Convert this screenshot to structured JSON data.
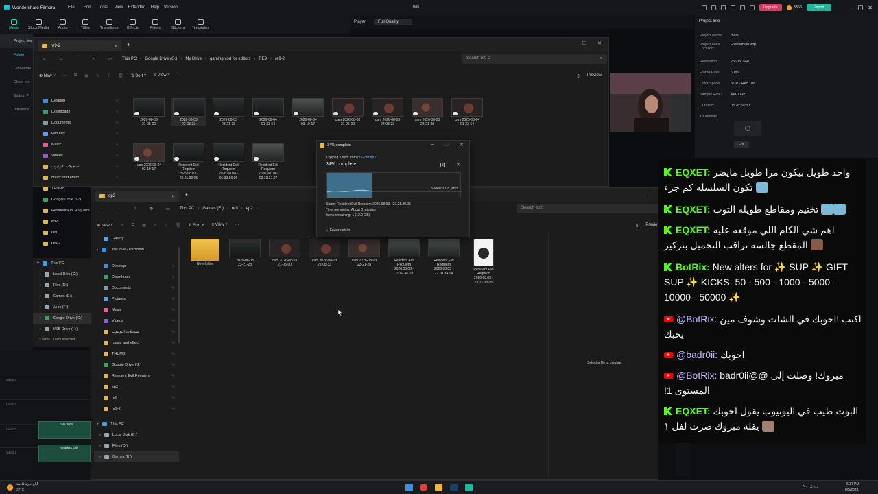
{
  "filmora": {
    "app_title": "Wondershare Filmora",
    "menu": [
      "File",
      "Edit",
      "Tools",
      "View",
      "Extended",
      "Help",
      "Version"
    ],
    "project": "main",
    "upgrade": "Upgrade",
    "credits": "3366",
    "export": "Export",
    "tools": [
      "Media",
      "Stock Media",
      "Audio",
      "Titles",
      "Transitions",
      "Effects",
      "Filters",
      "Stickers",
      "Templates"
    ],
    "left_items": [
      "Project Me",
      "Folder",
      "Global Me",
      "Cloud Me",
      "Editing Pr",
      "Influence"
    ],
    "player": {
      "label": "Player",
      "quality": "Full Quality"
    },
    "info": {
      "tab": "Project Info",
      "rows": [
        [
          "Project Name:",
          "main"
        ],
        [
          "Project Files Location:",
          "E:/re9/main.wfp"
        ],
        [
          "Resolution:",
          "2560 x 1440"
        ],
        [
          "Frame Rate:",
          "60fps"
        ],
        [
          "Color Space:",
          "SDR - Rec.709"
        ],
        [
          "Sample Rate:",
          "44100Hz"
        ],
        [
          "Duration:",
          "03:26:59:30"
        ],
        [
          "Thumbnail:",
          ""
        ]
      ],
      "edit": "Edit"
    },
    "timeline": {
      "tracks": [
        "Video 4",
        "Video 3",
        "Video 2",
        "Video 1"
      ],
      "clip_label": "Resident Evil",
      "clip_label2": "cam 2026"
    }
  },
  "explorer_back": {
    "tab": "re9-2",
    "crumbs": [
      "This PC",
      "Google Drive (G:)",
      "My Drive",
      "gaming vod for editors",
      "RE9",
      "re9-2"
    ],
    "search": "Search re9-2",
    "toolbar": {
      "new": "New",
      "sort": "Sort",
      "view": "View",
      "preview": "Preview"
    },
    "sidebar": [
      "Desktop",
      "Downloads",
      "Documents",
      "Pictures",
      "Music",
      "Videos",
      "تسجيلات اليوتيوب",
      "music and effect",
      "THUMB",
      "Google Drive (G:)",
      "Resident Evil Requiem",
      "ep2",
      "re9",
      "re9-2"
    ],
    "files": [
      [
        "2026-08-03",
        "21-05-00"
      ],
      [
        "2026-08-03",
        "22-08-33"
      ],
      [
        "2026-08-03",
        "23-21-28"
      ],
      [
        "2026-08-04",
        "01-33-54"
      ],
      [
        "2026-08-04",
        "03-19-17"
      ],
      [
        "cam 2026-08-03",
        "21-05-00"
      ],
      [
        "cam 2026-08-03",
        "22-08-33"
      ],
      [
        "cam 2026-08-03",
        "23-21-28"
      ],
      [
        "cam 2026-08-04",
        "01-33-54"
      ],
      [
        "cam 2026-08-04",
        "03-19-17"
      ],
      [
        "Resident Evil",
        "Requiem",
        "2026.08.03 -",
        "23.21.30.05"
      ],
      [
        "Resident Evil",
        "Requiem",
        "2026.08.04 -",
        "01.33.56.06"
      ],
      [
        "Resident Evil",
        "Requiem",
        "2026.08.04 -",
        "03.19.17.07"
      ]
    ]
  },
  "explorer_front": {
    "tab": "ep2",
    "crumbs": [
      "This PC",
      "Games (E:)",
      "re9",
      "ep2"
    ],
    "search": "Search ep2",
    "toolbar": {
      "new": "New",
      "sort": "Sort",
      "view": "View",
      "preview": "Preview"
    },
    "sidebar_top": [
      "Gallery",
      "OneDrive - Personal"
    ],
    "sidebar": [
      "Desktop",
      "Downloads",
      "Documents",
      "Pictures",
      "Music",
      "Videos",
      "تسجيلات اليوتيوب",
      "music and effect",
      "THUMB",
      "Google Drive (G:)",
      "Resident Evil Requiem",
      "ep2",
      "re9",
      "re9-2"
    ],
    "this_pc": "This PC",
    "drives": [
      "Local Disk (C:)",
      "Files (D:)",
      "Games (E:)"
    ],
    "files": [
      [
        "New folder"
      ],
      [
        "2026-08-03",
        "23-21-28"
      ],
      [
        "cam 2026-08-03",
        "21-05-00"
      ],
      [
        "cam 2026-08-03",
        "22-08-33"
      ],
      [
        "cam 2026-08-03",
        "23-21-28"
      ],
      [
        "Resident Evil",
        "Requiem",
        "2026.08.03 -",
        "21.07.46.03"
      ],
      [
        "Resident Evil",
        "Requiem",
        "2026.08.03 -",
        "22.08.34.04"
      ],
      [
        "Resident Evil",
        "Requiem",
        "2026.08.03 -",
        "23.21.30.05"
      ]
    ],
    "select_preview": "Select a file to preview.",
    "status_items": "13 items",
    "status_sel": "1 item selected"
  },
  "left_drive_list": {
    "this_pc": "This PC",
    "drives": [
      "Local Disk (C:)",
      "Files (D:)",
      "Games (E:)",
      "Apps (F:)",
      "Google Drive (G:)",
      "USB Drive (H:)"
    ]
  },
  "copy_dialog": {
    "title": "34% complete",
    "copying_pre": "Copying 1 item from ",
    "from": "re9-2",
    "to_word": " to ",
    "to": "ep2",
    "heading": "34% complete",
    "progress": 0.34,
    "speed": "Speed: 61.8 MB/s",
    "name": "Name: Resident Evil Requiem 2026.08.03 - 23.21.30.05",
    "time": "Time remaining: About 8 minutes",
    "items": "Items remaining: 1 (12.0 GB)",
    "fewer": "Fewer details"
  },
  "chat": [
    {
      "platform": "kick",
      "user": "EQXET:",
      "text": "واحد طويل بيكون مرا طويل مايضر تكون السلسله كم جزء"
    },
    {
      "platform": "kick",
      "user": "EQXET:",
      "text": "تختيم ومقاطع طويله التوب"
    },
    {
      "platform": "kick",
      "user": "EQXET:",
      "text": "اهم شي الكام اللي موقعه عليه المقطع جالسه تراقب التحميل بتركيز"
    },
    {
      "platform": "kick",
      "user": "BotRix:",
      "text": "New alters for ✨ SUP ✨ GIFT SUP ✨ KICKS: 50 - 500 - 1000 - 5000 - 10000 - 50000 ✨"
    },
    {
      "platform": "youtube",
      "user": "@BotRix:",
      "text": "اكتب !احوبك في الشات وشوف مين يحبك"
    },
    {
      "platform": "youtube",
      "user": "@badr0ii:",
      "text": "احوبك"
    },
    {
      "platform": "youtube",
      "user": "@BotRix:",
      "text": "مبروك! وصلت إلى @@badr0ii المستوى 1!"
    },
    {
      "platform": "kick",
      "user": "EQXET:",
      "text": "البوت طيب في اليوتيوب يقول احوبك يقله مبروك صرت لفل ١"
    }
  ],
  "taskbar": {
    "weather": "أيام حارة قادمة",
    "temp": "37°C",
    "time": "6:37 PM",
    "date": "8/5/2026"
  },
  "colors": {
    "kick": "#53fc18",
    "accent": "#1fb59a",
    "upgrade": "#d43b5f",
    "folder": "#e8b64b"
  }
}
